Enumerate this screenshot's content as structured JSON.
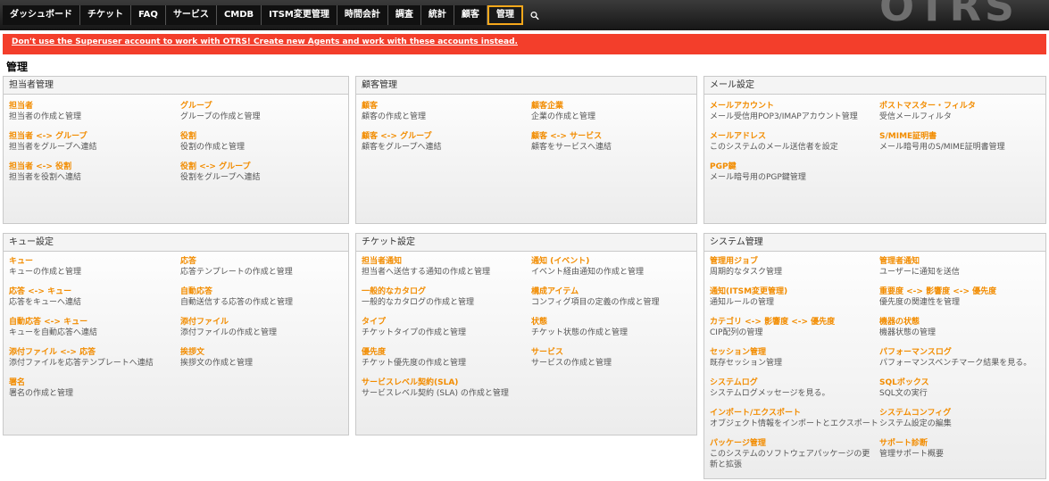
{
  "nav": {
    "items": [
      "ダッシュボード",
      "チケット",
      "FAQ",
      "サービス",
      "CMDB",
      "ITSM変更管理",
      "時間会計",
      "調査",
      "統計",
      "顧客",
      "管理"
    ],
    "brand": "OTRS"
  },
  "notice": "Don't use the Superuser account to work with OTRS! Create new Agents and work with these accounts instead.",
  "page_title": "管理",
  "panels": [
    {
      "title": "担当者管理",
      "items": [
        {
          "title": "担当者",
          "desc": "担当者の作成と管理"
        },
        {
          "title": "グループ",
          "desc": "グループの作成と管理"
        },
        {
          "title": "担当者 <-> グループ",
          "desc": "担当者をグループへ連結"
        },
        {
          "title": "役割",
          "desc": "役割の作成と管理"
        },
        {
          "title": "担当者 <-> 役割",
          "desc": "担当者を役割へ連結"
        },
        {
          "title": "役割 <-> グループ",
          "desc": "役割をグループへ連結"
        }
      ]
    },
    {
      "title": "顧客管理",
      "items": [
        {
          "title": "顧客",
          "desc": "顧客の作成と管理"
        },
        {
          "title": "顧客企業",
          "desc": "企業の作成と管理"
        },
        {
          "title": "顧客 <-> グループ",
          "desc": "顧客をグループへ連結"
        },
        {
          "title": "顧客 <-> サービス",
          "desc": "顧客をサービスへ連結"
        }
      ]
    },
    {
      "title": "メール設定",
      "items": [
        {
          "title": "メールアカウント",
          "desc": "メール受信用POP3/IMAPアカウント管理"
        },
        {
          "title": "ポストマスター・フィルタ",
          "desc": "受信メールフィルタ"
        },
        {
          "title": "メールアドレス",
          "desc": "このシステムのメール送信者を設定"
        },
        {
          "title": "S/MIME証明書",
          "desc": "メール暗号用のS/MIME証明書管理"
        },
        {
          "title": "PGP鍵",
          "desc": "メール暗号用のPGP鍵管理"
        }
      ]
    },
    {
      "title": "キュー設定",
      "items": [
        {
          "title": "キュー",
          "desc": "キューの作成と管理"
        },
        {
          "title": "応答",
          "desc": "応答テンプレートの作成と管理"
        },
        {
          "title": "応答 <-> キュー",
          "desc": "応答をキューへ連結"
        },
        {
          "title": "自動応答",
          "desc": "自動送信する応答の作成と管理"
        },
        {
          "title": "自動応答 <-> キュー",
          "desc": "キューを自動応答へ連結"
        },
        {
          "title": "添付ファイル",
          "desc": "添付ファイルの作成と管理"
        },
        {
          "title": "添付ファイル <-> 応答",
          "desc": "添付ファイルを応答テンプレートへ連結"
        },
        {
          "title": "挨拶文",
          "desc": "挨拶文の作成と管理"
        },
        {
          "title": "署名",
          "desc": "署名の作成と管理"
        }
      ]
    },
    {
      "title": "チケット設定",
      "items": [
        {
          "title": "担当者通知",
          "desc": "担当者へ送信する通知の作成と管理"
        },
        {
          "title": "通知 (イベント)",
          "desc": "イベント経由通知の作成と管理"
        },
        {
          "title": "一般的なカタログ",
          "desc": "一般的なカタログの作成と管理"
        },
        {
          "title": "構成アイテム",
          "desc": "コンフィグ項目の定義の作成と管理"
        },
        {
          "title": "タイプ",
          "desc": "チケットタイプの作成と管理"
        },
        {
          "title": "状態",
          "desc": "チケット状態の作成と管理"
        },
        {
          "title": "優先度",
          "desc": "チケット優先度の作成と管理"
        },
        {
          "title": "サービス",
          "desc": "サービスの作成と管理"
        },
        {
          "title": "サービスレベル契約(SLA)",
          "desc": "サービスレベル契約 (SLA) の作成と管理"
        }
      ]
    },
    {
      "title": "システム管理",
      "items": [
        {
          "title": "管理用ジョブ",
          "desc": "周期的なタスク管理"
        },
        {
          "title": "管理者通知",
          "desc": "ユーザーに通知を送信"
        },
        {
          "title": "通知(ITSM変更管理)",
          "desc": "通知ルールの管理"
        },
        {
          "title": "重要度 <-> 影響度 <-> 優先度",
          "desc": "優先度の関連性を管理"
        },
        {
          "title": "カテゴリ <-> 影響度 <-> 優先度",
          "desc": "CIP配列の管理"
        },
        {
          "title": "機器の状態",
          "desc": "機器状態の管理"
        },
        {
          "title": "セッション管理",
          "desc": "既存セッション管理"
        },
        {
          "title": "パフォーマンスログ",
          "desc": "パフォーマンスベンチマーク結果を見る。"
        },
        {
          "title": "システムログ",
          "desc": "システムログメッセージを見る。"
        },
        {
          "title": "SQLボックス",
          "desc": "SQL文の実行"
        },
        {
          "title": "インポート/エクスポート",
          "desc": "オブジェクト情報をインポートとエクスポート"
        },
        {
          "title": "システムコンフィグ",
          "desc": "システム設定の編集"
        },
        {
          "title": "パッケージ管理",
          "desc": "このシステムのソフトウェアパッケージの更新と拡張"
        },
        {
          "title": "サポート診断",
          "desc": "管理サポート概要"
        }
      ]
    }
  ]
}
